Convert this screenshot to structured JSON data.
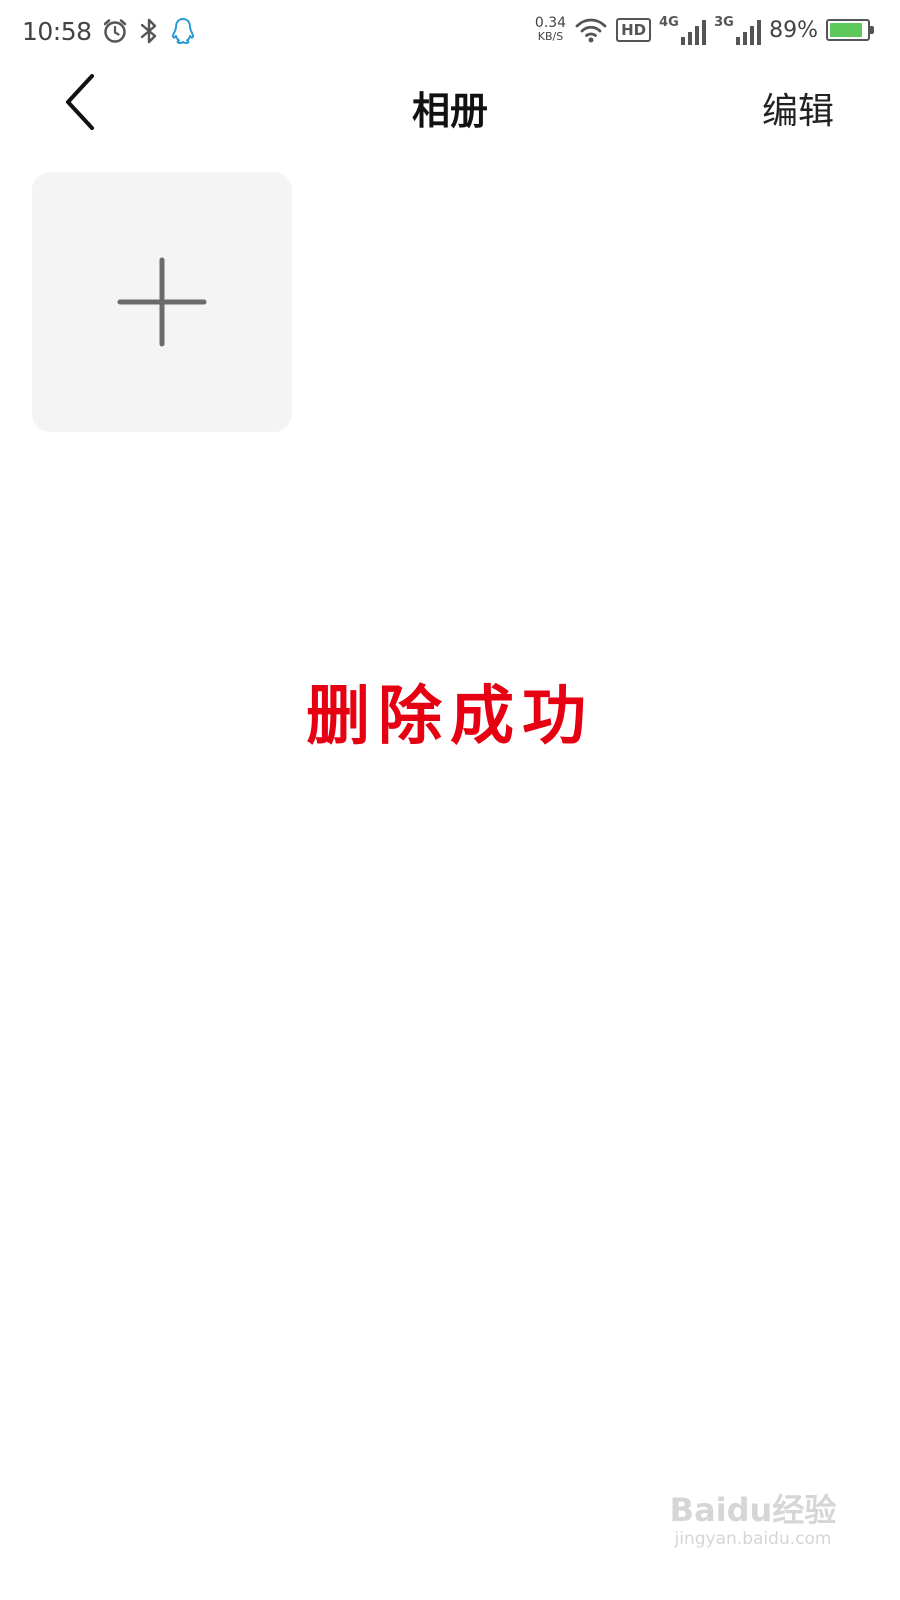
{
  "status_bar": {
    "time": "10:58",
    "icons": [
      "alarm-icon",
      "bluetooth-icon",
      "qq-icon"
    ],
    "net_speed_value": "0.34",
    "net_speed_unit": "KB/S",
    "hd_label": "HD",
    "signal_1_label": "4G",
    "signal_2_label": "3G",
    "battery_percent": "89%",
    "battery_level": 0.89,
    "battery_color": "#5cc95a"
  },
  "nav": {
    "back_icon": "chevron-left-icon",
    "title": "相册",
    "edit_label": "编辑"
  },
  "content": {
    "add_album_icon": "plus-icon",
    "tile_bg_color": "#f4f4f4"
  },
  "toast": {
    "message": "删除成功",
    "color": "#e60012"
  },
  "watermark": {
    "brand": "Baidu经验",
    "url": "jingyan.baidu.com"
  }
}
